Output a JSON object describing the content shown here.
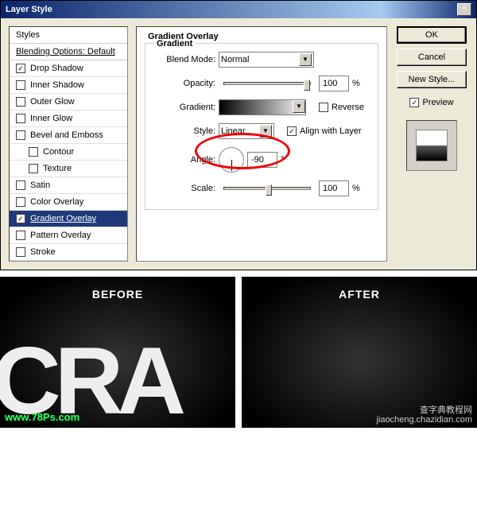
{
  "titlebar": {
    "title": "Layer Style",
    "close": "×"
  },
  "sidebar": {
    "header": "Styles",
    "blending": "Blending Options: Default",
    "items": [
      {
        "label": "Drop Shadow",
        "checked": true
      },
      {
        "label": "Inner Shadow",
        "checked": false
      },
      {
        "label": "Outer Glow",
        "checked": false
      },
      {
        "label": "Inner Glow",
        "checked": false
      },
      {
        "label": "Bevel and Emboss",
        "checked": false
      },
      {
        "label": "Contour",
        "checked": false,
        "indent": true
      },
      {
        "label": "Texture",
        "checked": false,
        "indent": true
      },
      {
        "label": "Satin",
        "checked": false
      },
      {
        "label": "Color Overlay",
        "checked": false
      },
      {
        "label": "Gradient Overlay",
        "checked": true,
        "selected": true
      },
      {
        "label": "Pattern Overlay",
        "checked": false
      },
      {
        "label": "Stroke",
        "checked": false
      }
    ]
  },
  "main": {
    "title": "Gradient Overlay",
    "group": "Gradient",
    "blend_mode_label": "Blend Mode:",
    "blend_mode_value": "Normal",
    "opacity_label": "Opacity:",
    "opacity_value": "100",
    "opacity_unit": "%",
    "gradient_label": "Gradient:",
    "reverse_label": "Reverse",
    "style_label": "Style:",
    "style_value": "Linear",
    "align_label": "Align with Layer",
    "angle_label": "Angle:",
    "angle_value": "-90",
    "angle_unit": "°",
    "scale_label": "Scale:",
    "scale_value": "100",
    "scale_unit": "%"
  },
  "right": {
    "ok": "OK",
    "cancel": "Cancel",
    "new_style": "New Style...",
    "preview": "Preview"
  },
  "bottom": {
    "before": "BEFORE",
    "after": "AFTER",
    "text": "CRA",
    "wm_left": "www.78Ps.com",
    "wm_right_1": "查字典教程网",
    "wm_right_2": "jiaocheng.chazidian.com"
  }
}
